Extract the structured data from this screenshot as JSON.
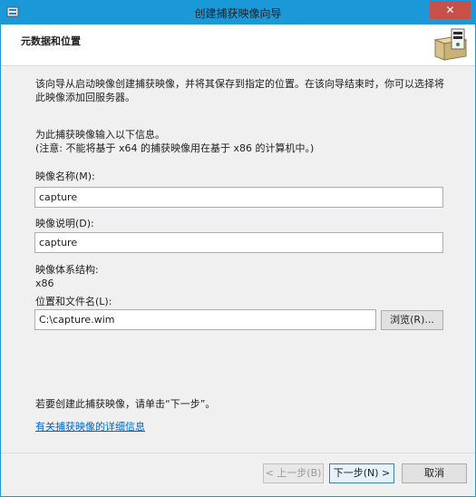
{
  "window": {
    "title": "创建捕获映像向导",
    "close_label": "✕"
  },
  "header": {
    "title": "元数据和位置"
  },
  "content": {
    "description": "该向导从启动映像创建捕获映像，并将其保存到指定的位置。在该向导结束时，你可以选择将此映像添加回服务器。",
    "info_line1": "为此捕获映像输入以下信息。",
    "info_line2": "(注意: 不能将基于 x64 的捕获映像用在基于 x86 的计算机中。)",
    "image_name_label": "映像名称(M):",
    "image_name_value": "capture",
    "image_desc_label": "映像说明(D):",
    "image_desc_value": "capture",
    "arch_label": "映像体系结构:",
    "arch_value": "x86",
    "location_label": "位置和文件名(L):",
    "location_value": "C:\\capture.wim",
    "browse_label": "浏览(R)...",
    "hint": "若要创建此捕获映像，请单击“下一步”。",
    "help_link": "有关捕获映像的详细信息"
  },
  "buttons": {
    "back": "< 上一步(B)",
    "next": "下一步(N) >",
    "cancel": "取消"
  }
}
